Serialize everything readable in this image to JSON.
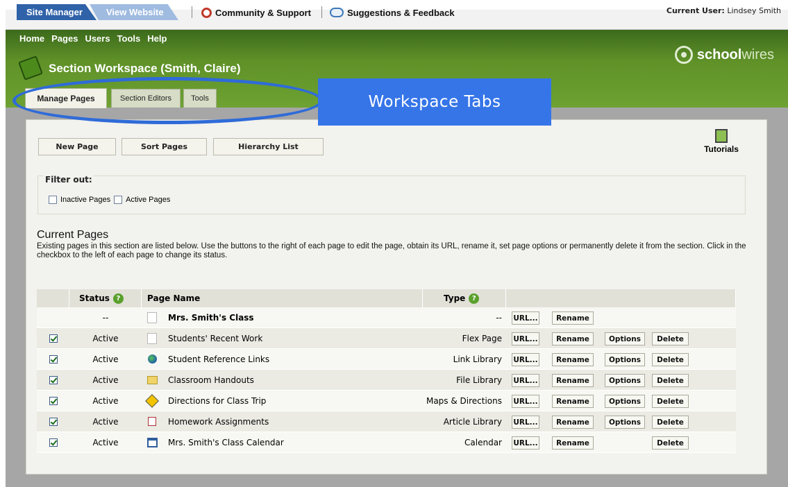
{
  "top_bar": {
    "tabs": [
      "Site Manager",
      "View Website"
    ],
    "links": [
      {
        "label": "Community & Support",
        "icon": "lifebuoy-icon"
      },
      {
        "label": "Suggestions & Feedback",
        "icon": "magnifier-comment-icon"
      }
    ],
    "current_user_label": "Current User:",
    "current_user_name": "Lindsey Smith"
  },
  "menu": [
    "Home",
    "Pages",
    "Users",
    "Tools",
    "Help"
  ],
  "logo": {
    "bold": "school",
    "light": "wires"
  },
  "section_title": "Section Workspace (Smith, Claire)",
  "workspace_tabs": [
    "Manage Pages",
    "Section Editors",
    "Tools"
  ],
  "annotation": {
    "label": "Workspace Tabs",
    "color": "#3575e8"
  },
  "toolbar": {
    "new_page": "New Page",
    "sort_pages": "Sort Pages",
    "hierarchy_list": "Hierarchy List",
    "tutorials": "Tutorials"
  },
  "filter": {
    "legend": "Filter out:",
    "options": [
      "Inactive Pages",
      "Active Pages"
    ]
  },
  "current_pages": {
    "title": "Current Pages",
    "description": "Existing pages in this section are listed below. Use the buttons to the right of each page to edit the page, obtain its URL, rename it, set page options or permanently delete it from the section. Click in the checkbox to the left of each page to change its status."
  },
  "table": {
    "headers": {
      "status": "Status",
      "page_name": "Page Name",
      "type": "Type"
    },
    "action_labels": {
      "url": "URL...",
      "rename": "Rename",
      "options": "Options",
      "delete": "Delete"
    },
    "rows": [
      {
        "checked": false,
        "status": "--",
        "icon": "page-icon",
        "name": "Mrs. Smith's Class",
        "type": "--",
        "bold": true,
        "options": false,
        "delete": false
      },
      {
        "checked": true,
        "status": "Active",
        "icon": "page-icon",
        "name": "Students' Recent Work",
        "type": "Flex Page",
        "bold": false,
        "options": true,
        "delete": true
      },
      {
        "checked": true,
        "status": "Active",
        "icon": "globe-icon",
        "name": "Student Reference Links",
        "type": "Link Library",
        "bold": false,
        "options": true,
        "delete": true
      },
      {
        "checked": true,
        "status": "Active",
        "icon": "folder-icon",
        "name": "Classroom Handouts",
        "type": "File Library",
        "bold": false,
        "options": true,
        "delete": true
      },
      {
        "checked": true,
        "status": "Active",
        "icon": "map-sign-icon",
        "name": "Directions for Class Trip",
        "type": "Maps & Directions",
        "bold": false,
        "options": true,
        "delete": true
      },
      {
        "checked": true,
        "status": "Active",
        "icon": "article-icon",
        "name": "Homework Assignments",
        "type": "Article Library",
        "bold": false,
        "options": true,
        "delete": true
      },
      {
        "checked": true,
        "status": "Active",
        "icon": "calendar-icon",
        "name": "Mrs. Smith's Class Calendar",
        "type": "Calendar",
        "bold": false,
        "options": false,
        "delete": true
      }
    ]
  }
}
